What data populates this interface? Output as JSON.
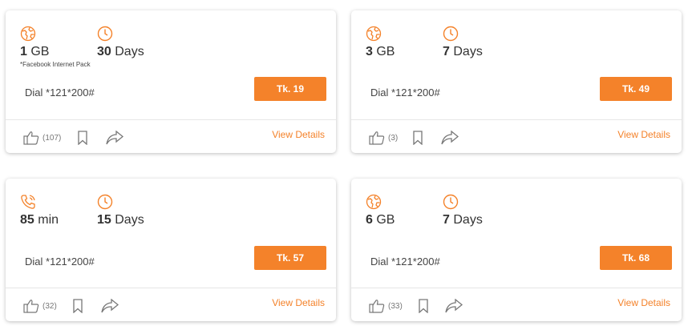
{
  "theme": {
    "accent": "#f4822a",
    "text": "#333333",
    "muted": "#777777"
  },
  "cards": [
    {
      "primary_icon": "globe-icon",
      "primary_value": "1",
      "primary_unit": "GB",
      "note": "*Facebook Internet Pack",
      "validity_icon": "clock-icon",
      "validity_value": "30",
      "validity_unit": "Days",
      "dial": "Dial *121*200#",
      "price": "Tk. 19",
      "likes": "(107)",
      "details_label": "View Details"
    },
    {
      "primary_icon": "globe-icon",
      "primary_value": "3",
      "primary_unit": "GB",
      "validity_icon": "clock-icon",
      "validity_value": "7",
      "validity_unit": "Days",
      "dial": "Dial *121*200#",
      "price": "Tk. 49",
      "likes": "(3)",
      "details_label": "View Details"
    },
    {
      "primary_icon": "phone-call-icon",
      "primary_value": "85",
      "primary_unit": "min",
      "validity_icon": "clock-icon",
      "validity_value": "15",
      "validity_unit": "Days",
      "dial": "Dial *121*200#",
      "price": "Tk. 57",
      "likes": "(32)",
      "details_label": "View Details"
    },
    {
      "primary_icon": "globe-icon",
      "primary_value": "6",
      "primary_unit": "GB",
      "validity_icon": "clock-icon",
      "validity_value": "7",
      "validity_unit": "Days",
      "dial": "Dial *121*200#",
      "price": "Tk. 68",
      "likes": "(33)",
      "details_label": "View Details"
    }
  ]
}
